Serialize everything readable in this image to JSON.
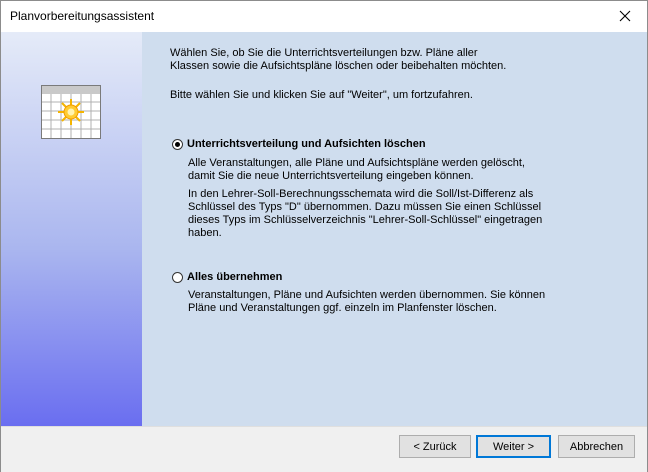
{
  "window": {
    "title": "Planvorbereitungsassistent"
  },
  "intro": {
    "line1": "Wählen Sie, ob Sie die Unterrichtsverteilungen bzw. Pläne aller",
    "line2": "Klassen sowie die Aufsichtspläne löschen oder beibehalten möchten.",
    "line3": "Bitte wählen Sie und klicken Sie auf \"Weiter\", um fortzufahren."
  },
  "options": [
    {
      "label": "Unterrichtsverteilung und Aufsichten löschen",
      "selected": true,
      "desc": [
        "Alle Veranstaltungen, alle Pläne und Aufsichtspläne werden gelöscht,",
        "damit Sie die neue Unterrichtsverteilung eingeben können.",
        "In den Lehrer-Soll-Berechnungsschemata wird die Soll/Ist-Differenz als",
        "Schlüssel des Typs \"D\" übernommen. Dazu müssen Sie einen Schlüssel",
        "dieses Typs im Schlüsselverzeichnis \"Lehrer-Soll-Schlüssel\" eingetragen",
        "haben."
      ]
    },
    {
      "label": "Alles übernehmen",
      "selected": false,
      "desc": [
        "Veranstaltungen, Pläne und Aufsichten werden übernommen. Sie können",
        "Pläne und Veranstaltungen ggf. einzeln im Planfenster löschen."
      ]
    }
  ],
  "buttons": {
    "back": "< Zurück",
    "next": "Weiter >",
    "cancel": "Abbrechen"
  },
  "icons": {
    "app": "calendar-sun-icon",
    "close": "close-icon"
  }
}
